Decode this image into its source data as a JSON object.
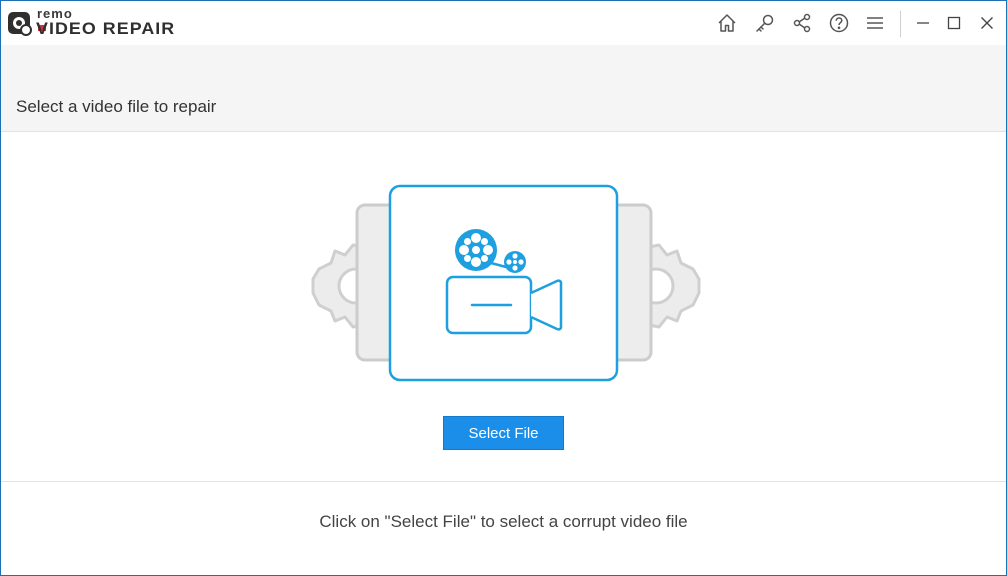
{
  "app": {
    "logo_small": "remo",
    "logo_product": "VIDEO REPAIR"
  },
  "titlebar": {
    "icons": [
      "home-icon",
      "key-icon",
      "share-icon",
      "help-icon",
      "menu-icon",
      "minimize-icon",
      "maximize-icon",
      "close-icon"
    ]
  },
  "main": {
    "title": "Select a video file to repair",
    "select_button_label": "Select File",
    "hint": "Click on \"Select File\" to select a corrupt video file"
  },
  "colors": {
    "accent": "#1a8ee8",
    "illustration_blue": "#1ea0e0",
    "gear_gray": "#d4d4d4",
    "window_border": "#1e6fb3"
  }
}
